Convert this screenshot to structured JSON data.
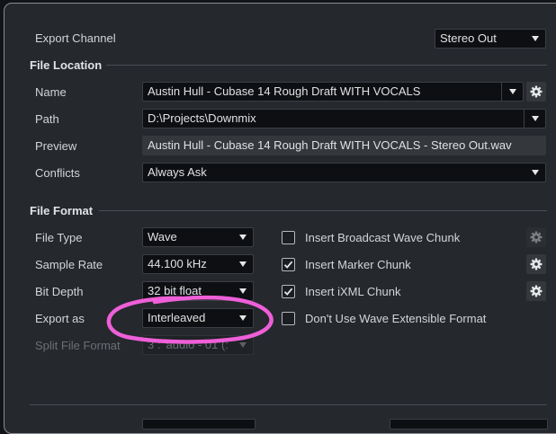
{
  "export_channel": {
    "label": "Export Channel",
    "value": "Stereo Out"
  },
  "file_location": {
    "title": "File Location",
    "name": {
      "label": "Name",
      "value": "Austin Hull - Cubase 14 Rough Draft WITH VOCALS"
    },
    "path": {
      "label": "Path",
      "value": "D:\\Projects\\Downmix"
    },
    "preview": {
      "label": "Preview",
      "value": "Austin Hull - Cubase 14 Rough Draft WITH VOCALS - Stereo Out.wav"
    },
    "conflicts": {
      "label": "Conflicts",
      "value": "Always Ask"
    }
  },
  "file_format": {
    "title": "File Format",
    "file_type": {
      "label": "File Type",
      "value": "Wave"
    },
    "sample_rate": {
      "label": "Sample Rate",
      "value": "44.100 kHz"
    },
    "bit_depth": {
      "label": "Bit Depth",
      "value": "32 bit float"
    },
    "export_as": {
      "label": "Export as",
      "value": "Interleaved"
    },
    "split_file_format": {
      "label": "Split File Format",
      "value": "3 : 'audio - 01 (:"
    },
    "options": [
      {
        "label": "Insert Broadcast Wave Chunk",
        "checked": false,
        "gear_enabled": false
      },
      {
        "label": "Insert Marker Chunk",
        "checked": true,
        "gear_enabled": true
      },
      {
        "label": "Insert iXML Chunk",
        "checked": true,
        "gear_enabled": true
      },
      {
        "label": "Don't Use Wave Extensible Format",
        "checked": false,
        "gear_enabled": null
      }
    ]
  },
  "colors": {
    "window_bg": "#25282d",
    "field_bg": "#0d0f12",
    "annotation": "#ee5fd8"
  }
}
